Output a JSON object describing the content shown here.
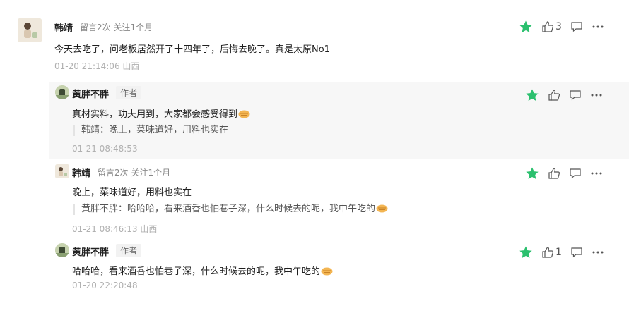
{
  "comments": [
    {
      "nickname": "韩靖",
      "meta": "留言2次 关注1个月",
      "content": "今天去吃了，问老板居然开了十四年了，后悔去晚了。真是太原No1",
      "time": "01-20 21:14:06 山西",
      "like_count": "3",
      "starred": true
    }
  ],
  "replies": [
    {
      "nickname": "黄胖不胖",
      "badge": "作者",
      "content": "真材实料，功夫用到，大家都会感受得到",
      "quote": "韩靖：晚上，菜味道好，用料也实在",
      "time": "01-21 08:48:53"
    },
    {
      "nickname": "韩靖",
      "meta": "留言2次 关注1个月",
      "content": "晚上，菜味道好，用料也实在",
      "quote": "黄胖不胖：哈哈哈，看来酒香也怕巷子深，什么时候去的呢，我中午吃的",
      "time": "01-21 08:46:13 山西"
    },
    {
      "nickname": "黄胖不胖",
      "badge": "作者",
      "content": "哈哈哈，看来酒香也怕巷子深，什么时候去的呢，我中午吃的",
      "time": "01-20 22:20:48",
      "like_count": "1"
    }
  ],
  "icons": {
    "star": "star-icon",
    "like": "thumbs-up-icon",
    "reply": "comment-icon",
    "more": "more-icon",
    "emoji": "handshake-emoji"
  },
  "colors": {
    "star": "#2bc06e",
    "muted": "#b0b0b0"
  }
}
